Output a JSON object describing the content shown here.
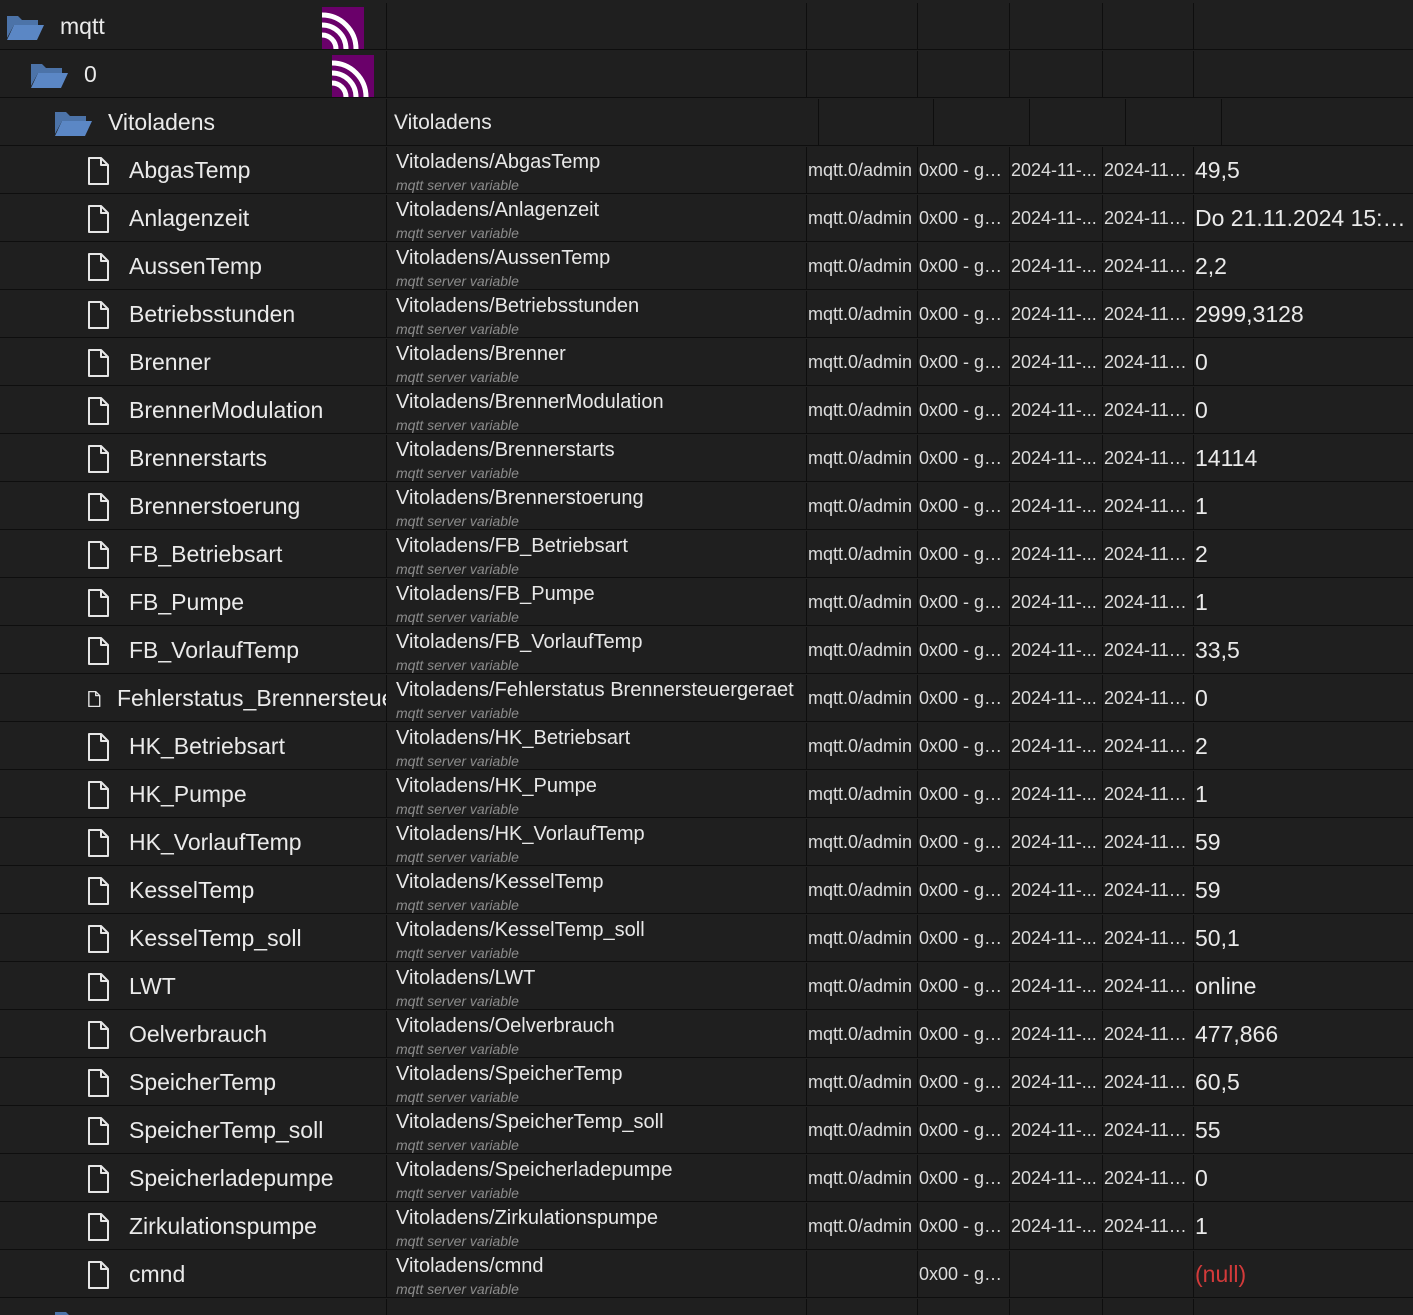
{
  "tree": {
    "root": {
      "label": "mqtt",
      "icon": "folder-open-icon",
      "adapter_icon": "mqtt-logo-icon"
    },
    "instance": {
      "label": "0",
      "icon": "folder-open-icon",
      "adapter_icon": "mqtt-logo-icon"
    },
    "channel": {
      "label": "Vitoladens",
      "title": "Vitoladens",
      "icon": "folder-open-icon"
    },
    "states": [
      {
        "name": "AbgasTemp",
        "title": "Vitoladens/AbgasTemp",
        "desc": "mqtt server variable",
        "role": "mqtt.0/admin",
        "acl": "0x00 - go...",
        "ts": "2024-11-...",
        "lc": "2024-11-...",
        "value": "49,5"
      },
      {
        "name": "Anlagenzeit",
        "title": "Vitoladens/Anlagenzeit",
        "desc": "mqtt server variable",
        "role": "mqtt.0/admin",
        "acl": "0x00 - go...",
        "ts": "2024-11-...",
        "lc": "2024-11-...",
        "value": "Do 21.11.2024 15:4..."
      },
      {
        "name": "AussenTemp",
        "title": "Vitoladens/AussenTemp",
        "desc": "mqtt server variable",
        "role": "mqtt.0/admin",
        "acl": "0x00 - go...",
        "ts": "2024-11-...",
        "lc": "2024-11-...",
        "value": "2,2"
      },
      {
        "name": "Betriebsstunden",
        "title": "Vitoladens/Betriebsstunden",
        "desc": "mqtt server variable",
        "role": "mqtt.0/admin",
        "acl": "0x00 - go...",
        "ts": "2024-11-...",
        "lc": "2024-11-...",
        "value": "2999,3128"
      },
      {
        "name": "Brenner",
        "title": "Vitoladens/Brenner",
        "desc": "mqtt server variable",
        "role": "mqtt.0/admin",
        "acl": "0x00 - go...",
        "ts": "2024-11-...",
        "lc": "2024-11-...",
        "value": "0"
      },
      {
        "name": "BrennerModulation",
        "title": "Vitoladens/BrennerModulation",
        "desc": "mqtt server variable",
        "role": "mqtt.0/admin",
        "acl": "0x00 - go...",
        "ts": "2024-11-...",
        "lc": "2024-11-...",
        "value": "0"
      },
      {
        "name": "Brennerstarts",
        "title": "Vitoladens/Brennerstarts",
        "desc": "mqtt server variable",
        "role": "mqtt.0/admin",
        "acl": "0x00 - go...",
        "ts": "2024-11-...",
        "lc": "2024-11-...",
        "value": "14114"
      },
      {
        "name": "Brennerstoerung",
        "title": "Vitoladens/Brennerstoerung",
        "desc": "mqtt server variable",
        "role": "mqtt.0/admin",
        "acl": "0x00 - go...",
        "ts": "2024-11-...",
        "lc": "2024-11-...",
        "value": "1"
      },
      {
        "name": "FB_Betriebsart",
        "title": "Vitoladens/FB_Betriebsart",
        "desc": "mqtt server variable",
        "role": "mqtt.0/admin",
        "acl": "0x00 - go...",
        "ts": "2024-11-...",
        "lc": "2024-11-...",
        "value": "2"
      },
      {
        "name": "FB_Pumpe",
        "title": "Vitoladens/FB_Pumpe",
        "desc": "mqtt server variable",
        "role": "mqtt.0/admin",
        "acl": "0x00 - go...",
        "ts": "2024-11-...",
        "lc": "2024-11-...",
        "value": "1"
      },
      {
        "name": "FB_VorlaufTemp",
        "title": "Vitoladens/FB_VorlaufTemp",
        "desc": "mqtt server variable",
        "role": "mqtt.0/admin",
        "acl": "0x00 - go...",
        "ts": "2024-11-...",
        "lc": "2024-11-...",
        "value": "33,5"
      },
      {
        "name": "Fehlerstatus_Brennersteue",
        "title": "Vitoladens/Fehlerstatus Brennersteuergeraet",
        "desc": "mqtt server variable",
        "role": "mqtt.0/admin",
        "acl": "0x00 - go...",
        "ts": "2024-11-...",
        "lc": "2024-11-...",
        "value": "0",
        "small_icon": true
      },
      {
        "name": "HK_Betriebsart",
        "title": "Vitoladens/HK_Betriebsart",
        "desc": "mqtt server variable",
        "role": "mqtt.0/admin",
        "acl": "0x00 - go...",
        "ts": "2024-11-...",
        "lc": "2024-11-...",
        "value": "2"
      },
      {
        "name": "HK_Pumpe",
        "title": "Vitoladens/HK_Pumpe",
        "desc": "mqtt server variable",
        "role": "mqtt.0/admin",
        "acl": "0x00 - go...",
        "ts": "2024-11-...",
        "lc": "2024-11-...",
        "value": "1"
      },
      {
        "name": "HK_VorlaufTemp",
        "title": "Vitoladens/HK_VorlaufTemp",
        "desc": "mqtt server variable",
        "role": "mqtt.0/admin",
        "acl": "0x00 - go...",
        "ts": "2024-11-...",
        "lc": "2024-11-...",
        "value": "59"
      },
      {
        "name": "KesselTemp",
        "title": "Vitoladens/KesselTemp",
        "desc": "mqtt server variable",
        "role": "mqtt.0/admin",
        "acl": "0x00 - go...",
        "ts": "2024-11-...",
        "lc": "2024-11-...",
        "value": "59"
      },
      {
        "name": "KesselTemp_soll",
        "title": "Vitoladens/KesselTemp_soll",
        "desc": "mqtt server variable",
        "role": "mqtt.0/admin",
        "acl": "0x00 - go...",
        "ts": "2024-11-...",
        "lc": "2024-11-...",
        "value": "50,1"
      },
      {
        "name": "LWT",
        "title": "Vitoladens/LWT",
        "desc": "mqtt server variable",
        "role": "mqtt.0/admin",
        "acl": "0x00 - go...",
        "ts": "2024-11-...",
        "lc": "2024-11-...",
        "value": "online"
      },
      {
        "name": "Oelverbrauch",
        "title": "Vitoladens/Oelverbrauch",
        "desc": "mqtt server variable",
        "role": "mqtt.0/admin",
        "acl": "0x00 - go...",
        "ts": "2024-11-...",
        "lc": "2024-11-...",
        "value": "477,866"
      },
      {
        "name": "SpeicherTemp",
        "title": "Vitoladens/SpeicherTemp",
        "desc": "mqtt server variable",
        "role": "mqtt.0/admin",
        "acl": "0x00 - go...",
        "ts": "2024-11-...",
        "lc": "2024-11-...",
        "value": "60,5"
      },
      {
        "name": "SpeicherTemp_soll",
        "title": "Vitoladens/SpeicherTemp_soll",
        "desc": "mqtt server variable",
        "role": "mqtt.0/admin",
        "acl": "0x00 - go...",
        "ts": "2024-11-...",
        "lc": "2024-11-...",
        "value": "55"
      },
      {
        "name": "Speicherladepumpe",
        "title": "Vitoladens/Speicherladepumpe",
        "desc": "mqtt server variable",
        "role": "mqtt.0/admin",
        "acl": "0x00 - go...",
        "ts": "2024-11-...",
        "lc": "2024-11-...",
        "value": "0"
      },
      {
        "name": "Zirkulationspumpe",
        "title": "Vitoladens/Zirkulationspumpe",
        "desc": "mqtt server variable",
        "role": "mqtt.0/admin",
        "acl": "0x00 - go...",
        "ts": "2024-11-...",
        "lc": "2024-11-...",
        "value": "1"
      },
      {
        "name": "cmnd",
        "title": "Vitoladens/cmnd",
        "desc": "mqtt server variable",
        "role": "",
        "acl": "0x00 - go...",
        "ts": "",
        "lc": "",
        "value": "(null)",
        "value_null": true
      }
    ]
  },
  "colors": {
    "background": "#1f1f1f",
    "folder": "#5b87c5",
    "mqtt_logo": "#6a006a",
    "null_value": "#d33a3a",
    "desc_text": "#8c8c8c"
  }
}
